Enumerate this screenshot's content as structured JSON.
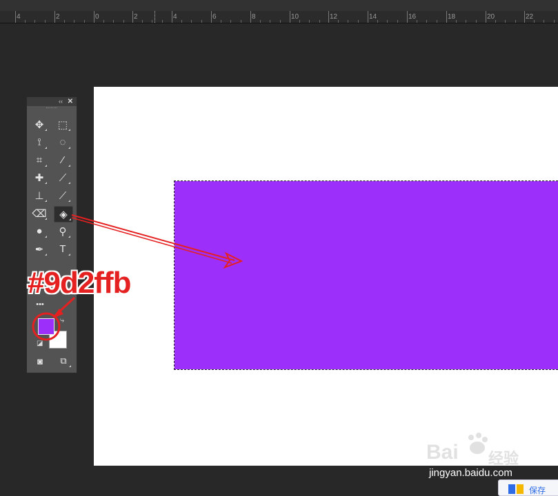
{
  "ruler": {
    "labels": [
      "4",
      "2",
      "0",
      "2",
      "4",
      "6",
      "8",
      "10",
      "12",
      "14",
      "16",
      "18",
      "20",
      "22"
    ]
  },
  "document": {
    "canvas_color": "#ffffff",
    "selection_fill": "#9d2ffb"
  },
  "toolbox": {
    "collapse_label": "‹‹",
    "close_label": "✕",
    "tools": [
      {
        "name": "move-tool",
        "icon": "move-icon",
        "glyph": "✥"
      },
      {
        "name": "marquee-tool",
        "icon": "rect-marquee-icon",
        "glyph": "⬚"
      },
      {
        "name": "lasso-tool",
        "icon": "lasso-icon",
        "glyph": "⟟"
      },
      {
        "name": "quick-select-tool",
        "icon": "quick-select-icon",
        "glyph": "◌"
      },
      {
        "name": "crop-tool",
        "icon": "crop-icon",
        "glyph": "⌗"
      },
      {
        "name": "eyedropper-tool",
        "icon": "eyedropper-icon",
        "glyph": "⁄"
      },
      {
        "name": "healing-tool",
        "icon": "bandage-icon",
        "glyph": "✚"
      },
      {
        "name": "brush-tool",
        "icon": "brush-icon",
        "glyph": "⟋"
      },
      {
        "name": "stamp-tool",
        "icon": "stamp-icon",
        "glyph": "⊥"
      },
      {
        "name": "history-brush-tool",
        "icon": "history-brush-icon",
        "glyph": "⟋"
      },
      {
        "name": "eraser-tool",
        "icon": "eraser-icon",
        "glyph": "⌫"
      },
      {
        "name": "paint-bucket-tool",
        "icon": "paint-bucket-icon",
        "glyph": "◈"
      },
      {
        "name": "blur-tool",
        "icon": "drop-icon",
        "glyph": "●"
      },
      {
        "name": "dodge-tool",
        "icon": "dodge-icon",
        "glyph": "⚲"
      },
      {
        "name": "pen-tool",
        "icon": "pen-icon",
        "glyph": "✒"
      },
      {
        "name": "type-tool",
        "icon": "type-icon",
        "glyph": "T"
      }
    ],
    "more_label": "•••",
    "foreground_color": "#9d2ffb",
    "background_color": "#ffffff"
  },
  "annotation": {
    "label": "#9d2ffb",
    "color": "#e52020"
  },
  "watermark": {
    "logo_text": "Bai",
    "logo_suffix": "经验",
    "url": "jingyan.baidu.com",
    "save_chip_text": "保存"
  }
}
